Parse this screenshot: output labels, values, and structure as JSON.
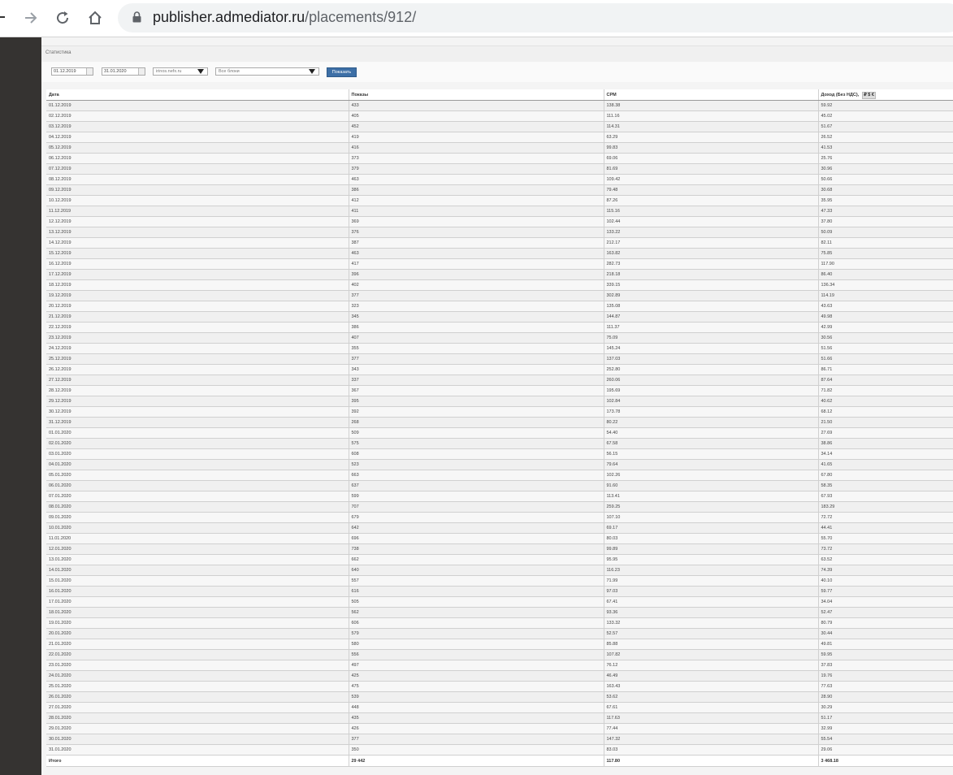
{
  "browser": {
    "url_host": "publisher.admediator.ru",
    "url_path": "/placements/912/"
  },
  "page": {
    "section_title": "Статистика",
    "filters": {
      "date_from": "01.12.2019",
      "date_to": "31.01.2020",
      "site": "irinos.nefx.ru",
      "blocks": "Все блоки",
      "show_button": "Показать"
    }
  },
  "table": {
    "headers": [
      "Дата",
      "Показы",
      "CPM",
      "Доход (Без НДС),"
    ],
    "currency_options": [
      "₽",
      "$",
      "€"
    ],
    "rows": [
      [
        "01.12.2019",
        "433",
        "138.38",
        "59.92"
      ],
      [
        "02.12.2019",
        "405",
        "111.16",
        "45.02"
      ],
      [
        "03.12.2019",
        "452",
        "114.31",
        "51.67"
      ],
      [
        "04.12.2019",
        "419",
        "63.29",
        "26.52"
      ],
      [
        "05.12.2019",
        "416",
        "99.83",
        "41.53"
      ],
      [
        "06.12.2019",
        "373",
        "69.06",
        "25.76"
      ],
      [
        "07.12.2019",
        "379",
        "81.69",
        "30.96"
      ],
      [
        "08.12.2019",
        "463",
        "109.42",
        "50.66"
      ],
      [
        "09.12.2019",
        "386",
        "79.48",
        "30.68"
      ],
      [
        "10.12.2019",
        "412",
        "87.26",
        "35.95"
      ],
      [
        "11.12.2019",
        "411",
        "115.16",
        "47.33"
      ],
      [
        "12.12.2019",
        "369",
        "102.44",
        "37.80"
      ],
      [
        "13.12.2019",
        "376",
        "133.22",
        "50.09"
      ],
      [
        "14.12.2019",
        "387",
        "212.17",
        "82.11"
      ],
      [
        "15.12.2019",
        "463",
        "163.82",
        "75.85"
      ],
      [
        "16.12.2019",
        "417",
        "282.73",
        "117.90"
      ],
      [
        "17.12.2019",
        "396",
        "218.18",
        "86.40"
      ],
      [
        "18.12.2019",
        "402",
        "339.15",
        "136.34"
      ],
      [
        "19.12.2019",
        "377",
        "302.89",
        "114.19"
      ],
      [
        "20.12.2019",
        "323",
        "135.08",
        "43.63"
      ],
      [
        "21.12.2019",
        "345",
        "144.87",
        "49.98"
      ],
      [
        "22.12.2019",
        "386",
        "111.37",
        "42.99"
      ],
      [
        "23.12.2019",
        "407",
        "75.09",
        "30.56"
      ],
      [
        "24.12.2019",
        "355",
        "145.24",
        "51.56"
      ],
      [
        "25.12.2019",
        "377",
        "137.03",
        "51.66"
      ],
      [
        "26.12.2019",
        "343",
        "252.80",
        "86.71"
      ],
      [
        "27.12.2019",
        "337",
        "260.06",
        "87.64"
      ],
      [
        "28.12.2019",
        "367",
        "195.69",
        "71.82"
      ],
      [
        "29.12.2019",
        "395",
        "102.84",
        "40.62"
      ],
      [
        "30.12.2019",
        "392",
        "173.78",
        "68.12"
      ],
      [
        "31.12.2019",
        "268",
        "80.22",
        "21.50"
      ],
      [
        "01.01.2020",
        "509",
        "54.40",
        "27.69"
      ],
      [
        "02.01.2020",
        "575",
        "67.58",
        "38.86"
      ],
      [
        "03.01.2020",
        "608",
        "56.15",
        "34.14"
      ],
      [
        "04.01.2020",
        "523",
        "79.64",
        "41.65"
      ],
      [
        "05.01.2020",
        "663",
        "102.26",
        "67.80"
      ],
      [
        "06.01.2020",
        "637",
        "91.60",
        "58.35"
      ],
      [
        "07.01.2020",
        "599",
        "113.41",
        "67.93"
      ],
      [
        "08.01.2020",
        "707",
        "259.25",
        "183.29"
      ],
      [
        "09.01.2020",
        "679",
        "107.10",
        "72.72"
      ],
      [
        "10.01.2020",
        "642",
        "69.17",
        "44.41"
      ],
      [
        "11.01.2020",
        "696",
        "80.03",
        "55.70"
      ],
      [
        "12.01.2020",
        "738",
        "99.89",
        "73.72"
      ],
      [
        "13.01.2020",
        "662",
        "95.95",
        "63.52"
      ],
      [
        "14.01.2020",
        "640",
        "116.23",
        "74.39"
      ],
      [
        "15.01.2020",
        "557",
        "71.99",
        "40.10"
      ],
      [
        "16.01.2020",
        "616",
        "97.03",
        "59.77"
      ],
      [
        "17.01.2020",
        "505",
        "67.41",
        "34.04"
      ],
      [
        "18.01.2020",
        "562",
        "93.36",
        "52.47"
      ],
      [
        "19.01.2020",
        "606",
        "133.32",
        "80.79"
      ],
      [
        "20.01.2020",
        "579",
        "52.57",
        "30.44"
      ],
      [
        "21.01.2020",
        "580",
        "85.88",
        "49.81"
      ],
      [
        "22.01.2020",
        "556",
        "107.82",
        "59.95"
      ],
      [
        "23.01.2020",
        "497",
        "76.12",
        "37.83"
      ],
      [
        "24.01.2020",
        "425",
        "46.49",
        "19.76"
      ],
      [
        "25.01.2020",
        "475",
        "163.43",
        "77.63"
      ],
      [
        "26.01.2020",
        "539",
        "53.62",
        "28.90"
      ],
      [
        "27.01.2020",
        "448",
        "67.61",
        "30.29"
      ],
      [
        "28.01.2020",
        "435",
        "117.63",
        "51.17"
      ],
      [
        "29.01.2020",
        "426",
        "77.44",
        "32.99"
      ],
      [
        "30.01.2020",
        "377",
        "147.32",
        "55.54"
      ],
      [
        "31.01.2020",
        "350",
        "83.03",
        "29.06"
      ]
    ],
    "total": [
      "Итого",
      "29 442",
      "117.80",
      "3 468.18"
    ]
  }
}
